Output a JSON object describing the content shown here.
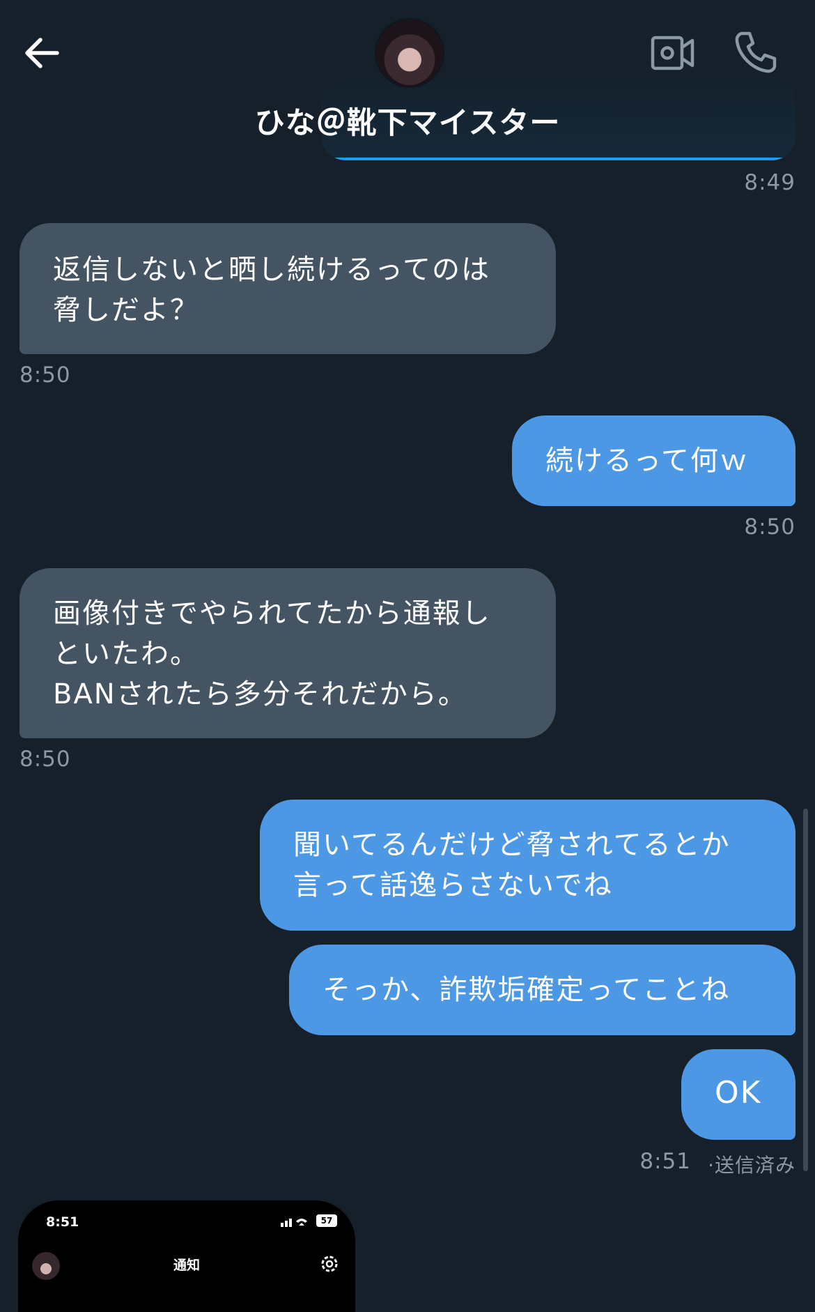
{
  "header": {
    "title": "ひな＠靴下マイスター",
    "icons": [
      "back-arrow-icon",
      "video-camera-icon",
      "phone-icon"
    ]
  },
  "messages": [
    {
      "side": "out",
      "text": "",
      "time": "8:49"
    },
    {
      "side": "in",
      "text": "返信しないと晒し続けるってのは\n脅しだよ？",
      "time": "8:50"
    },
    {
      "side": "out",
      "text": "続けるって何ｗ",
      "time": "8:50"
    },
    {
      "side": "in",
      "text": "画像付きでやられてたから通報し\nといたわ。\nBANされたら多分それだから。",
      "time": "8:50"
    },
    {
      "side": "out",
      "text": "聞いてるんだけど脅されてるとか\n言って話逸らさないでね"
    },
    {
      "side": "out",
      "text": "そっか、詐欺垢確定ってことね"
    },
    {
      "side": "out",
      "text": "OK",
      "time": "8:51",
      "status": "·送信済み"
    }
  ],
  "embedded_screenshot": {
    "time": "8:51",
    "battery": "57",
    "title": "通知"
  },
  "colors": {
    "background": "#15202b",
    "incoming_bubble": "#455462",
    "outgoing_bubble": "#4c98e4",
    "timestamp": "#8b98a5"
  }
}
